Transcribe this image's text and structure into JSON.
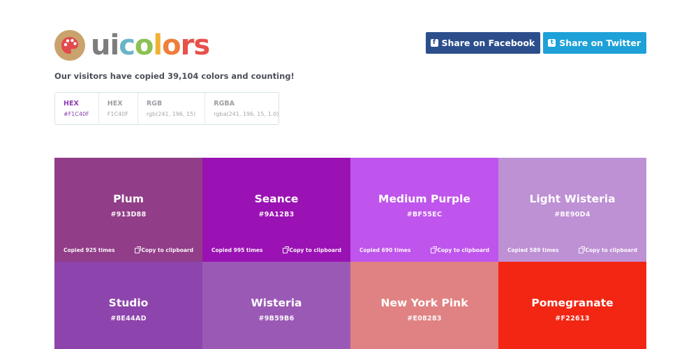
{
  "brand": {
    "letters": [
      {
        "ch": "u",
        "color": "#7d7d7d"
      },
      {
        "ch": "i",
        "color": "#7d7d7d"
      },
      {
        "ch": "c",
        "color": "#6ab5c8"
      },
      {
        "ch": "o",
        "color": "#8cc152"
      },
      {
        "ch": "l",
        "color": "#f2b134"
      },
      {
        "ch": "o",
        "color": "#ef7d3c"
      },
      {
        "ch": "r",
        "color": "#e8504a"
      },
      {
        "ch": "s",
        "color": "#e8504a"
      }
    ],
    "logo_icon": "palette-icon",
    "logo_bg": "#c9a26c"
  },
  "share": {
    "facebook": {
      "label": "Share on Facebook",
      "icon": "facebook-icon",
      "color": "#2c4f8c"
    },
    "twitter": {
      "label": "Share on Twitter",
      "icon": "twitter-icon",
      "color": "#1da1d8"
    }
  },
  "tagline": "Our visitors have copied 39,104 colors and counting!",
  "formats": [
    {
      "name": "HEX",
      "value": "#F1C40F",
      "active": true
    },
    {
      "name": "HEX",
      "value": "F1C40F",
      "active": false
    },
    {
      "name": "RGB",
      "value": "rgb(241, 196, 15)",
      "active": false
    },
    {
      "name": "RGBA",
      "value": "rgba(241, 196, 15, 1.0)",
      "active": false
    }
  ],
  "copy_label": "Copy to clipboard",
  "colors": [
    {
      "name": "Plum",
      "hex": "#913D88",
      "copied": "Copied 925 times"
    },
    {
      "name": "Seance",
      "hex": "#9A12B3",
      "copied": "Copied 995 times"
    },
    {
      "name": "Medium Purple",
      "hex": "#BF55EC",
      "copied": "Copied 690 times"
    },
    {
      "name": "Light Wisteria",
      "hex": "#BE90D4",
      "copied": "Copied 589 times"
    },
    {
      "name": "Studio",
      "hex": "#8E44AD",
      "copied": ""
    },
    {
      "name": "Wisteria",
      "hex": "#9B59B6",
      "copied": ""
    },
    {
      "name": "New York Pink",
      "hex": "#E08283",
      "copied": ""
    },
    {
      "name": "Pomegranate",
      "hex": "#F22613",
      "copied": ""
    }
  ]
}
